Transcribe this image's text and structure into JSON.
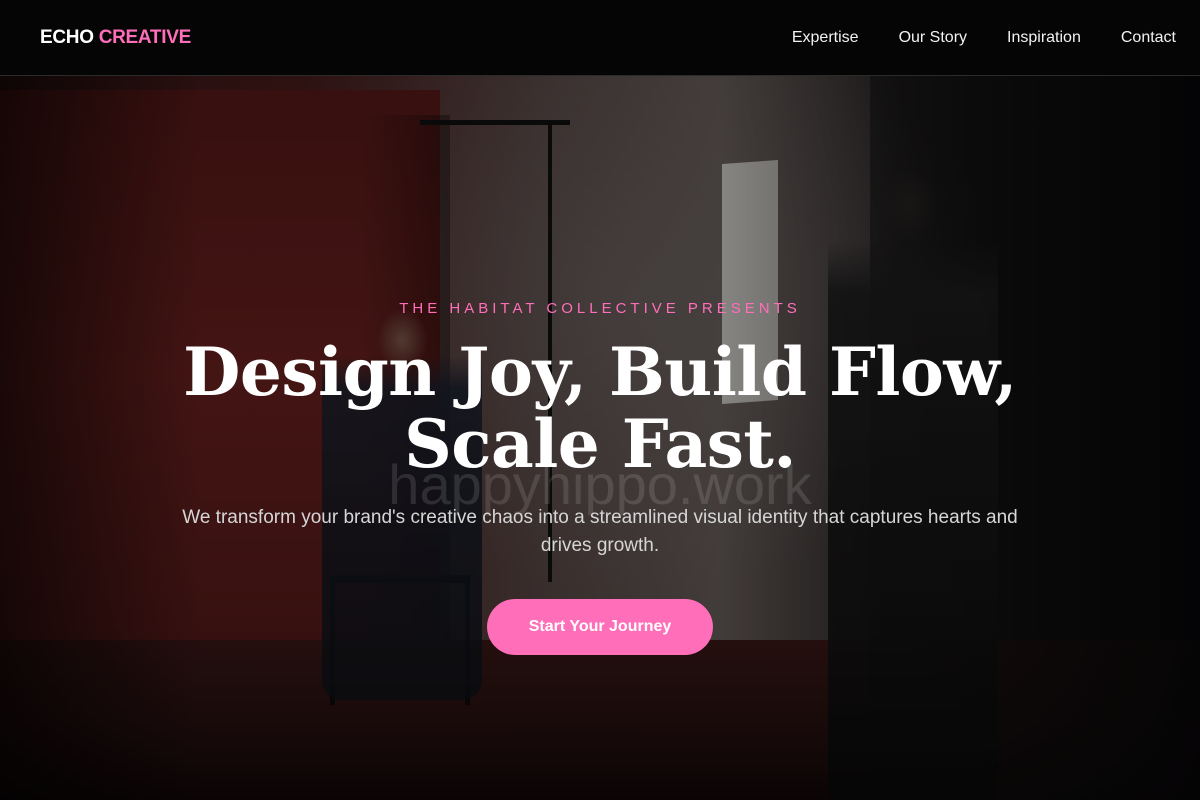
{
  "nav": {
    "logo_primary": "ECHO",
    "logo_accent": "CREATIVE",
    "links": [
      {
        "label": "Expertise"
      },
      {
        "label": "Our Story"
      },
      {
        "label": "Inspiration"
      },
      {
        "label": "Contact"
      }
    ]
  },
  "hero": {
    "eyebrow": "THE HABITAT COLLECTIVE PRESENTS",
    "headline_line1": "Design Joy, Build Flow,",
    "headline_line2": "Scale Fast.",
    "subtitle": "We transform your brand's creative chaos into a streamlined visual identity that captures hearts and drives growth.",
    "cta_label": "Start Your Journey",
    "watermark": "happyhippo.work",
    "background_image": "photo-studio-scene"
  },
  "colors": {
    "accent": "#ff6eb8",
    "nav_background": "#050505",
    "text": "#ffffff"
  }
}
